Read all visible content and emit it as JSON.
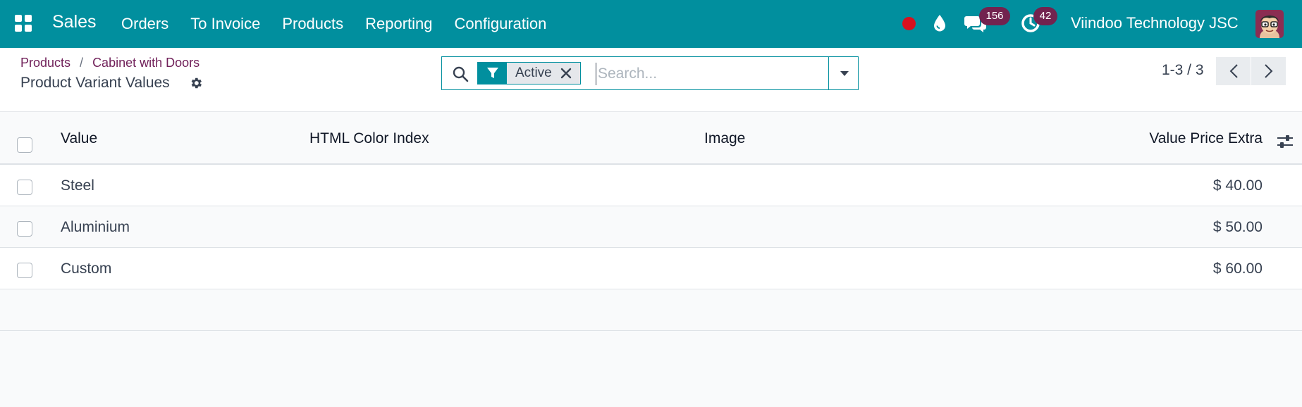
{
  "navbar": {
    "brand": "Sales",
    "menu": [
      "Orders",
      "To Invoice",
      "Products",
      "Reporting",
      "Configuration"
    ],
    "messages_count": "156",
    "activities_count": "42",
    "company": "Viindoo Technology JSC",
    "colors": {
      "background": "#018f9e",
      "badge": "#72234f",
      "recording": "#d7111f"
    }
  },
  "breadcrumb": [
    "Products",
    "Cabinet with Doors"
  ],
  "breadcrumb_separator": "/",
  "page_title": "Product Variant Values",
  "search": {
    "facet_label": "Active",
    "placeholder": "Search..."
  },
  "pager": {
    "value": "1-3 / 3"
  },
  "table": {
    "columns": [
      "Value",
      "HTML Color Index",
      "Image",
      "Value Price Extra"
    ],
    "rows": [
      {
        "value": "Steel",
        "html_color_index": "",
        "image": "",
        "price_extra": "$ 40.00"
      },
      {
        "value": "Aluminium",
        "html_color_index": "",
        "image": "",
        "price_extra": "$ 50.00"
      },
      {
        "value": "Custom",
        "html_color_index": "",
        "image": "",
        "price_extra": "$ 60.00"
      }
    ]
  },
  "icons": {
    "apps": "apps-grid-icon",
    "recording": "recording-dot-icon",
    "drop": "water-drop-icon",
    "chat": "chat-icon",
    "activity": "clock-icon",
    "gear": "gear-icon",
    "search": "search-icon",
    "filter": "filter-icon",
    "remove": "close-icon",
    "dropdown": "caret-down-icon",
    "prev": "chevron-left-icon",
    "next": "chevron-right-icon",
    "optional_columns": "sliders-icon"
  }
}
